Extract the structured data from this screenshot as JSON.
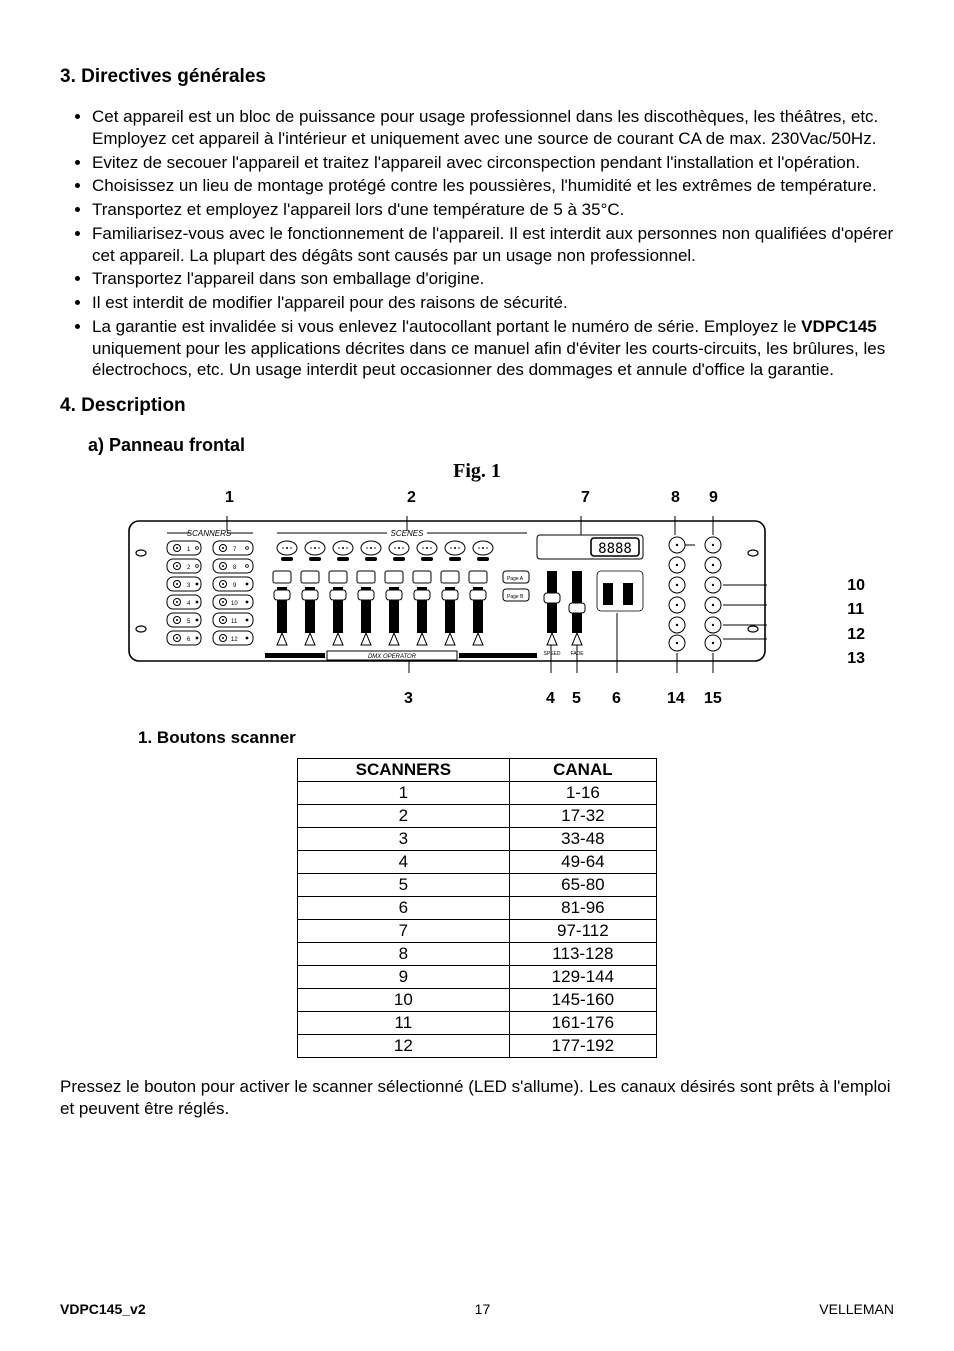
{
  "section3": {
    "num": "3.",
    "title": "Directives générales",
    "bullets": [
      "Cet appareil est un bloc de puissance pour usage professionnel dans les discothèques, les théâtres, etc. Employez cet appareil à l'intérieur et uniquement avec une source de courant CA de max. 230Vac/50Hz.",
      "Evitez de secouer l'appareil et traitez l'appareil avec circonspection pendant l'installation et l'opération.",
      "Choisissez un lieu de montage protégé contre les poussières, l'humidité et les extrêmes de température.",
      "Transportez et employez l'appareil lors d'une température de 5 à 35°C.",
      "Familiarisez-vous avec le fonctionnement de l'appareil. Il est interdit aux personnes non qualifiées d'opérer cet appareil. La plupart des dégâts sont causés par un usage non professionnel.",
      "Transportez l'appareil dans son emballage d'origine.",
      "Il est interdit de modifier l'appareil pour des raisons de sécurité."
    ],
    "bullet_warranty_pre": "La garantie est invalidée si vous enlevez l'autocollant portant le numéro de série. Employez le ",
    "bullet_warranty_bold": "VDPC145",
    "bullet_warranty_post": " uniquement pour les applications décrites dans ce manuel afin d'éviter les courts-circuits, les brûlures, les électrochocs, etc. Un usage interdit peut occasionner des dommages et annule d'office la garantie."
  },
  "section4": {
    "num": "4.",
    "title": "Description",
    "sub_a": "a) Panneau frontal",
    "fig_label": "Fig. 1",
    "fig_top": {
      "n1": "1",
      "n2": "2",
      "n7": "7",
      "n8": "8",
      "n9": "9"
    },
    "fig_side": {
      "n10": "10",
      "n11": "11",
      "n12": "12",
      "n13": "13"
    },
    "fig_bot": {
      "n3": "3",
      "n4": "4",
      "n5": "5",
      "n6": "6",
      "n14": "14",
      "n15": "15"
    },
    "panel": {
      "scanners_label": "SCANNERS",
      "scenes_label": "SCENES",
      "operator_label": "DMX OPERATOR",
      "display": "8888"
    },
    "sub1_num": "1.",
    "sub1_title": "Boutons scanner",
    "table": {
      "head_scanners": "SCANNERS",
      "head_canal": "CANAL",
      "rows": [
        {
          "s": "1",
          "c": "1-16"
        },
        {
          "s": "2",
          "c": "17-32"
        },
        {
          "s": "3",
          "c": "33-48"
        },
        {
          "s": "4",
          "c": "49-64"
        },
        {
          "s": "5",
          "c": "65-80"
        },
        {
          "s": "6",
          "c": "81-96"
        },
        {
          "s": "7",
          "c": "97-112"
        },
        {
          "s": "8",
          "c": "113-128"
        },
        {
          "s": "9",
          "c": "129-144"
        },
        {
          "s": "10",
          "c": "145-160"
        },
        {
          "s": "11",
          "c": "161-176"
        },
        {
          "s": "12",
          "c": "177-192"
        }
      ]
    },
    "para_after": "Pressez le bouton pour activer le scanner sélectionné (LED s'allume). Les canaux désirés sont prêts à l'emploi et peuvent être réglés."
  },
  "footer": {
    "left": "VDPC145_v2",
    "center": "17",
    "right": "VELLEMAN"
  }
}
